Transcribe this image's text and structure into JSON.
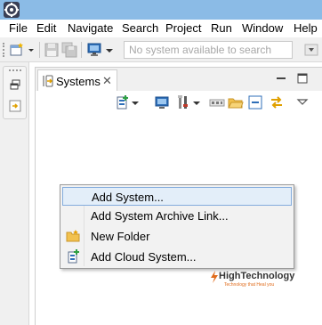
{
  "menubar": {
    "items": [
      {
        "label": "File"
      },
      {
        "label": "Edit"
      },
      {
        "label": "Navigate"
      },
      {
        "label": "Search"
      },
      {
        "label": "Project"
      },
      {
        "label": "Run"
      },
      {
        "label": "Window"
      },
      {
        "label": "Help"
      }
    ]
  },
  "toolbar": {
    "search_placeholder": "No system available to search"
  },
  "view": {
    "tab_label": "Systems",
    "tab_close": "✕"
  },
  "context_menu": {
    "items": [
      {
        "label": "Add System...",
        "icon": "none",
        "highlighted": true
      },
      {
        "label": "Add System Archive Link...",
        "icon": "none"
      },
      {
        "label": "New Folder",
        "icon": "folder-icon"
      },
      {
        "label": "Add Cloud System...",
        "icon": "cloud-system-icon"
      }
    ]
  },
  "watermark": {
    "title": "HighTechnology",
    "subtitle": "Technology that Heal you"
  },
  "colors": {
    "titlebar": "#8bbbe6",
    "highlight_bg": "#e3eef9",
    "highlight_border": "#84acdd",
    "watermark_accent": "#e06c1c"
  }
}
